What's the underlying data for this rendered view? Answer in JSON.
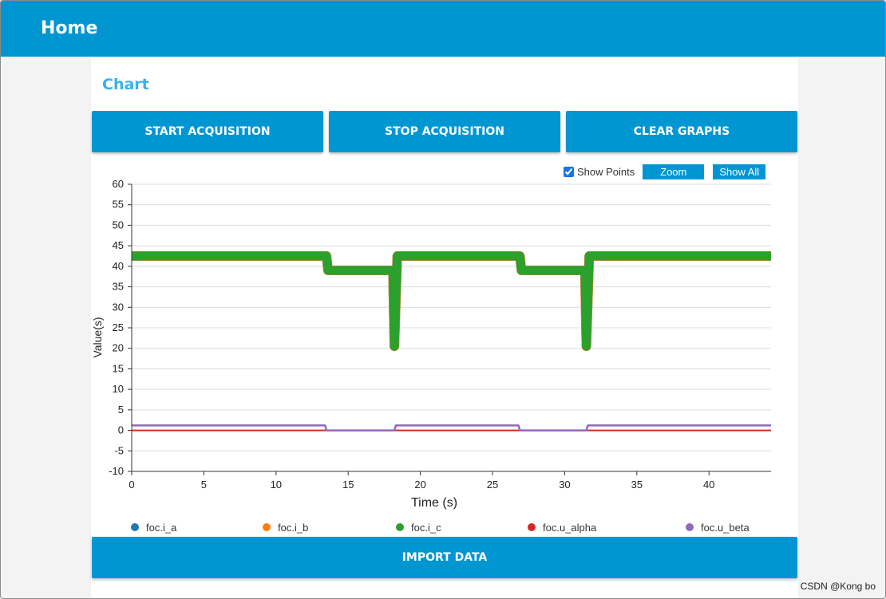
{
  "appbar": {
    "title": "Home"
  },
  "panel": {
    "heading": "Chart"
  },
  "buttons": {
    "start": "START ACQUISITION",
    "stop": "STOP ACQUISITION",
    "clear": "CLEAR GRAPHS",
    "import": "IMPORT DATA"
  },
  "toolbar": {
    "show_points_label": "Show Points",
    "show_points_checked": true,
    "zoom": "Zoom",
    "show_all": "Show All"
  },
  "watermark": "CSDN @Kong bo",
  "colors": {
    "accent": "#0096d1",
    "heading": "#35b3ee"
  },
  "chart_data": {
    "type": "line",
    "xlabel": "Time (s)",
    "ylabel": "Value(s)",
    "xlim": [
      0,
      44.3
    ],
    "ylim": [
      -10,
      60
    ],
    "xticks": [
      0,
      5,
      10,
      15,
      20,
      25,
      30,
      35,
      40
    ],
    "yticks": [
      60,
      55,
      50,
      45,
      40,
      35,
      30,
      25,
      20,
      15,
      10,
      5,
      0,
      -5,
      -10
    ],
    "grid": true,
    "legend_position": "bottom",
    "series": [
      {
        "name": "foc.i_a",
        "color": "#1f77b4",
        "x": [
          0,
          13.5,
          13.6,
          18.1,
          18.2,
          18.4,
          26.9,
          27.0,
          31.4,
          31.5,
          31.7,
          44.3
        ],
        "y": [
          42.5,
          42.5,
          39,
          39,
          20.5,
          42.5,
          42.5,
          39,
          39,
          20.5,
          42.5,
          42.5
        ]
      },
      {
        "name": "foc.i_b",
        "color": "#ff7f0e",
        "x": [
          0,
          13.5,
          13.6,
          18.1,
          18.2,
          18.4,
          26.9,
          27.0,
          31.4,
          31.5,
          31.7,
          44.3
        ],
        "y": [
          42.5,
          42.5,
          39,
          39,
          20.5,
          42.5,
          42.5,
          39,
          39,
          20.5,
          42.5,
          42.5
        ]
      },
      {
        "name": "foc.i_c",
        "color": "#2ca02c",
        "x": [
          0,
          13.5,
          13.6,
          18.1,
          18.2,
          18.4,
          26.9,
          27.0,
          31.4,
          31.5,
          31.7,
          44.3
        ],
        "y": [
          42.5,
          42.5,
          39,
          39,
          20.5,
          42.5,
          42.5,
          39,
          39,
          20.5,
          42.5,
          42.5
        ]
      },
      {
        "name": "foc.u_alpha",
        "color": "#d62728",
        "x": [
          0,
          44.3
        ],
        "y": [
          0,
          0
        ]
      },
      {
        "name": "foc.u_beta",
        "color": "#9467bd",
        "x": [
          0,
          13.4,
          13.5,
          18.2,
          18.3,
          26.8,
          26.9,
          31.5,
          31.6,
          44.3
        ],
        "y": [
          1.2,
          1.2,
          0,
          0,
          1.2,
          1.2,
          0,
          0,
          1.2,
          1.2
        ]
      }
    ]
  }
}
